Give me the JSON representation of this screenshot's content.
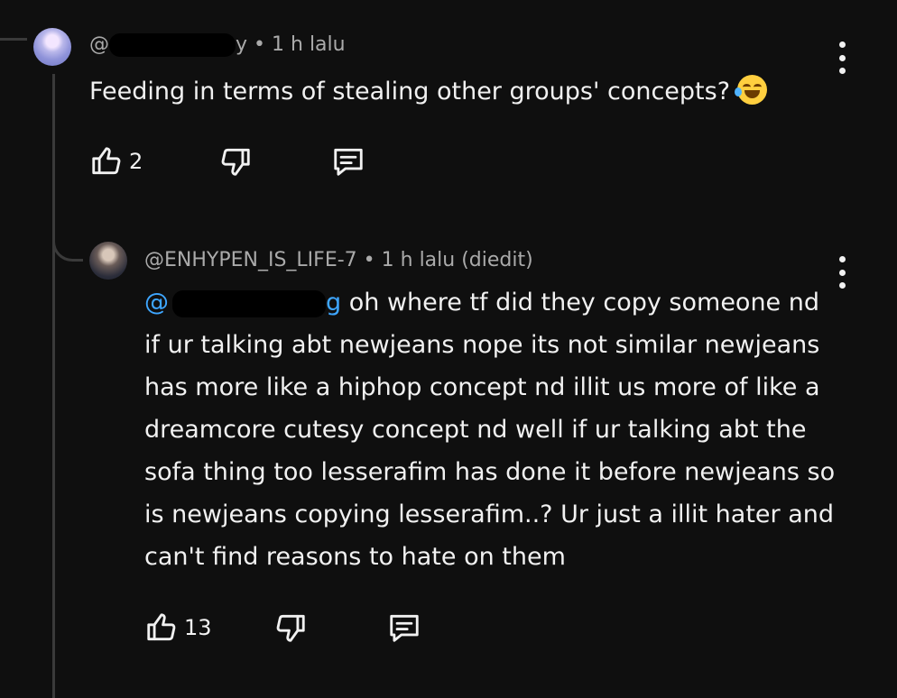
{
  "comments": [
    {
      "author_visible": "@",
      "author_suffix": "y",
      "time": "1 h lalu",
      "text": "Feeding in terms of stealing other groups' concepts?",
      "emoji": "face-with-tears-of-joy",
      "likes": "2"
    },
    {
      "author": "@ENHYPEN_IS_LIFE-7",
      "time": "1 h lalu (diedit)",
      "mention_visible": "@",
      "mention_suffix": "g",
      "text": "oh where tf did they copy someone nd if ur talking abt newjeans nope its not similar newjeans has more like a hiphop concept nd illit us more of like a dreamcore cutesy concept nd well if ur talking abt the sofa thing too lesserafim has done it before newjeans so is newjeans copying lesserafim..? Ur just a illit hater and can't find reasons to hate on them",
      "likes": "13"
    }
  ],
  "separator": "•",
  "colors": {
    "background": "#0f0f0f",
    "text": "#f1f1f1",
    "meta": "#aaaaaa",
    "mention": "#3ea6ff"
  },
  "icons": [
    "like-icon",
    "dislike-icon",
    "reply-icon",
    "more-vert-icon"
  ]
}
